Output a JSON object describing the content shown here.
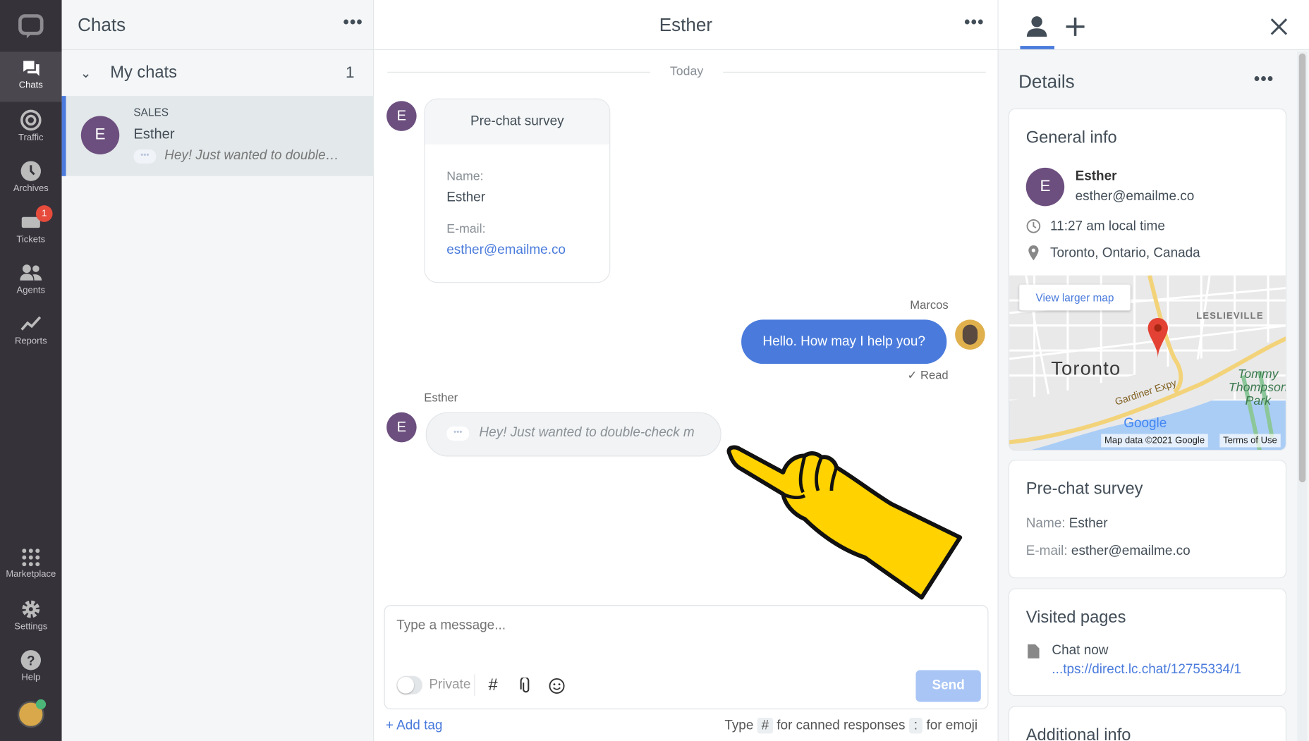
{
  "nav": {
    "items": [
      {
        "label": "Chats",
        "icon": "chats-icon",
        "active": true
      },
      {
        "label": "Traffic",
        "icon": "traffic-icon"
      },
      {
        "label": "Archives",
        "icon": "clock-icon"
      },
      {
        "label": "Tickets",
        "icon": "ticket-icon",
        "badge": "1"
      },
      {
        "label": "Agents",
        "icon": "agents-icon"
      },
      {
        "label": "Reports",
        "icon": "reports-icon"
      }
    ],
    "bottom": [
      {
        "label": "Marketplace",
        "icon": "grid-icon"
      },
      {
        "label": "Settings",
        "icon": "gear-icon"
      },
      {
        "label": "Help",
        "icon": "help-icon"
      }
    ]
  },
  "list": {
    "title": "Chats",
    "section": "My chats",
    "section_count": "1",
    "chat": {
      "group": "SALES",
      "initial": "E",
      "name": "Esther",
      "preview": "Hey! Just wanted to double…"
    }
  },
  "chat": {
    "title": "Esther",
    "day": "Today",
    "survey": {
      "title": "Pre-chat survey",
      "name_label": "Name:",
      "name": "Esther",
      "email_label": "E-mail:",
      "email": "esther@emailme.co"
    },
    "agent_name": "Marcos",
    "agent_msg": "Hello. How may I help you?",
    "read": "✓ Read",
    "visitor_name": "Esther",
    "visitor_initial": "E",
    "visitor_typing": "Hey! Just wanted to double-check m"
  },
  "composer": {
    "placeholder": "Type a message...",
    "private": "Private",
    "send": "Send",
    "add_tag": "+ Add tag",
    "hint_type": "Type",
    "hint_hash": "#",
    "hint_canned": "for canned responses",
    "hint_colon": ":",
    "hint_emoji": "for emoji"
  },
  "details": {
    "title": "Details",
    "general": {
      "title": "General info",
      "initial": "E",
      "name": "Esther",
      "email": "esther@emailme.co",
      "local_time": "11:27 am local time",
      "location": "Toronto, Ontario, Canada"
    },
    "map": {
      "view_larger": "View larger map",
      "city": "Toronto",
      "district": "LESLIEVILLE",
      "road": "Gardiner Expy",
      "park": "Tommy Thompson Park",
      "logo": "Google",
      "attribution": "Map data ©2021 Google",
      "terms": "Terms of Use"
    },
    "survey": {
      "title": "Pre-chat survey",
      "name_label": "Name:",
      "name": "Esther",
      "email_label": "E-mail:",
      "email": "esther@emailme.co"
    },
    "visited": {
      "title": "Visited pages",
      "page": "Chat now",
      "url": "...tps://direct.lc.chat/12755334/1"
    },
    "additional": {
      "title": "Additional info"
    }
  },
  "colors": {
    "accent": "#4a7bdc",
    "nav_bg": "#35323a",
    "avatar": "#6c4f7e",
    "cursor": "#ffd200"
  }
}
